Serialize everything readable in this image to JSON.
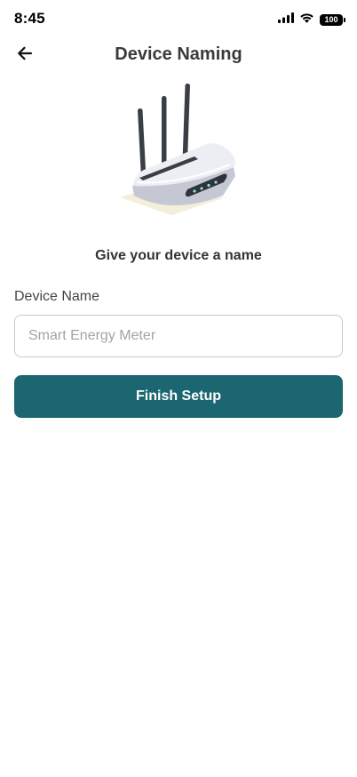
{
  "status_bar": {
    "time": "8:45",
    "battery": "100"
  },
  "header": {
    "title": "Device Naming"
  },
  "main": {
    "subtitle": "Give your device a name",
    "field_label": "Device Name",
    "name_input": {
      "value": "",
      "placeholder": "Smart Energy Meter"
    },
    "finish_label": "Finish Setup"
  },
  "colors": {
    "primary": "#1b6670",
    "title_text": "#3a3a3a",
    "input_border": "#c9c9c9",
    "placeholder": "#a3a3a3"
  },
  "icons": {
    "back": "arrow-left-icon",
    "signal": "cellular-signal-icon",
    "wifi": "wifi-icon",
    "battery": "battery-icon",
    "illustration": "wifi-router-illustration"
  }
}
